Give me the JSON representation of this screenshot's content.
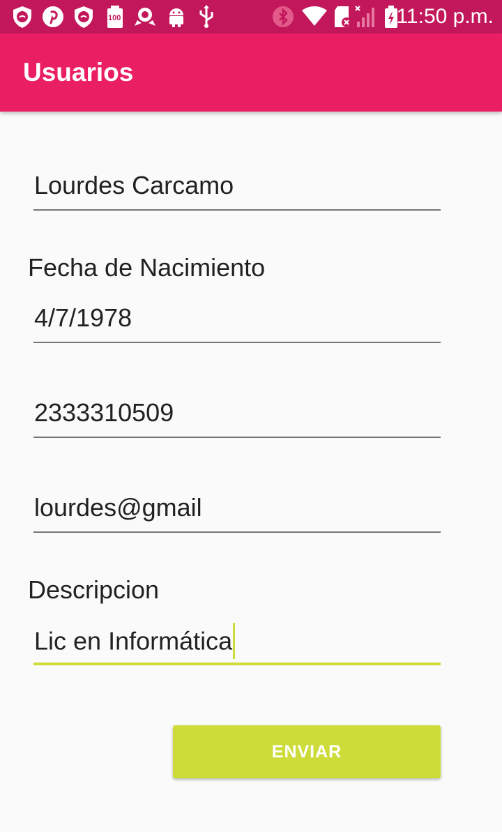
{
  "status_bar": {
    "time": "11:50 p.m.",
    "left_icons": [
      "shield-icon",
      "pinterest-icon",
      "shield-icon",
      "battery-100-icon",
      "rose-icon",
      "android-icon",
      "usb-icon"
    ],
    "right_icons": [
      "bluetooth-icon",
      "wifi-icon",
      "sd-card-icon",
      "signal-icon",
      "battery-charging-icon"
    ],
    "badge_100": "100"
  },
  "app_bar": {
    "title": "Usuarios"
  },
  "form": {
    "name_value": "Lourdes Carcamo",
    "birth_label": "Fecha de Nacimiento",
    "birth_value": "4/7/1978",
    "phone_value": "2333310509",
    "email_value": "lourdes@gmail",
    "description_label": "Descripcion",
    "description_value": "Lic en Informática"
  },
  "actions": {
    "submit_label": "ENVIAR"
  },
  "colors": {
    "status_bar": "#c2185b",
    "app_bar": "#e91e63",
    "accent": "#cddc39",
    "background": "#fafafa"
  }
}
